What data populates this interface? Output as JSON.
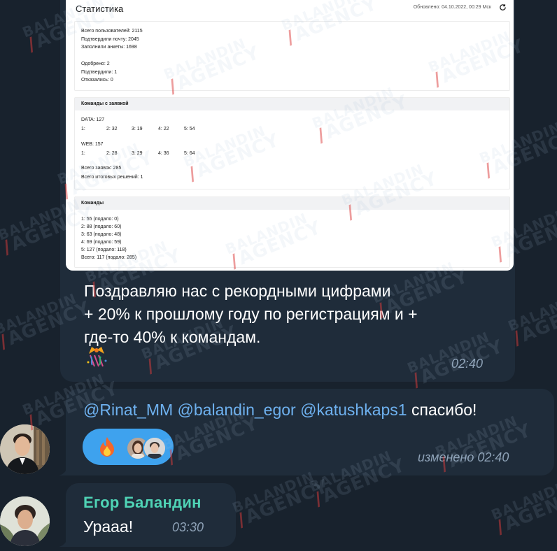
{
  "message1": {
    "stats_card": {
      "title": "Статистика",
      "updated": "Обновлено: 04.10.2022, 00:29 Мск",
      "summary": {
        "total_users": "Всего пользователей: 2115",
        "confirmed_email": "Подтвердили почту: 2045",
        "filled_forms": "Заполнили анкеты: 1698",
        "approved": "Одобрено: 2",
        "confirmed": "Подтвердили: 1",
        "declined": "Отказались: 0"
      },
      "teams_with_application": {
        "header": "Команды с заявкой",
        "data_label": "DATA: 127",
        "data_cols": [
          "1:",
          "2: 32",
          "3: 19",
          "4: 22",
          "5: 54"
        ],
        "web_label": "WEB: 157",
        "web_cols": [
          "1:",
          "2: 28",
          "3: 29",
          "4: 36",
          "5: 64"
        ],
        "total_applications": "Всего заявок:  285",
        "total_final_solutions": "Всего итоговых решений:  1"
      },
      "teams": {
        "header": "Команды",
        "rows": [
          "1: 55 (подало: 0)",
          "2: 88 (подало: 60)",
          "3: 63 (подало: 48)",
          "4: 69 (подало: 59)",
          "5: 127 (подало: 118)",
          "Всего: 117 (подало: 285)"
        ]
      }
    },
    "text_lines": [
      "Поздравляю нас с рекордными цифрами",
      "+ 20% к прошлому году по регистрациям и +",
      "где-то 40% к командам."
    ],
    "emoji": "confetti-emoji",
    "time": "02:40"
  },
  "message2": {
    "mentions": [
      "@Rinat_MM",
      "@balandin_egor",
      "@katushkaps1"
    ],
    "text": "спасибо!",
    "reaction": {
      "emoji": "fire-icon",
      "color": "#3ea2ee"
    },
    "time": "изменено 02:40"
  },
  "message3": {
    "sender": "Егор Баландин",
    "text": "Урааа!",
    "time": "03:30"
  },
  "watermark": {
    "line1": "BALANDIN",
    "line2": "AGENCY"
  },
  "colors": {
    "background": "#18222d",
    "bubble": "#1f2c3a",
    "mention": "#6eb1ef",
    "sender_name": "#4fd3b5",
    "time": "#8ea2b7",
    "reaction_pill": "#3ea2ee"
  }
}
